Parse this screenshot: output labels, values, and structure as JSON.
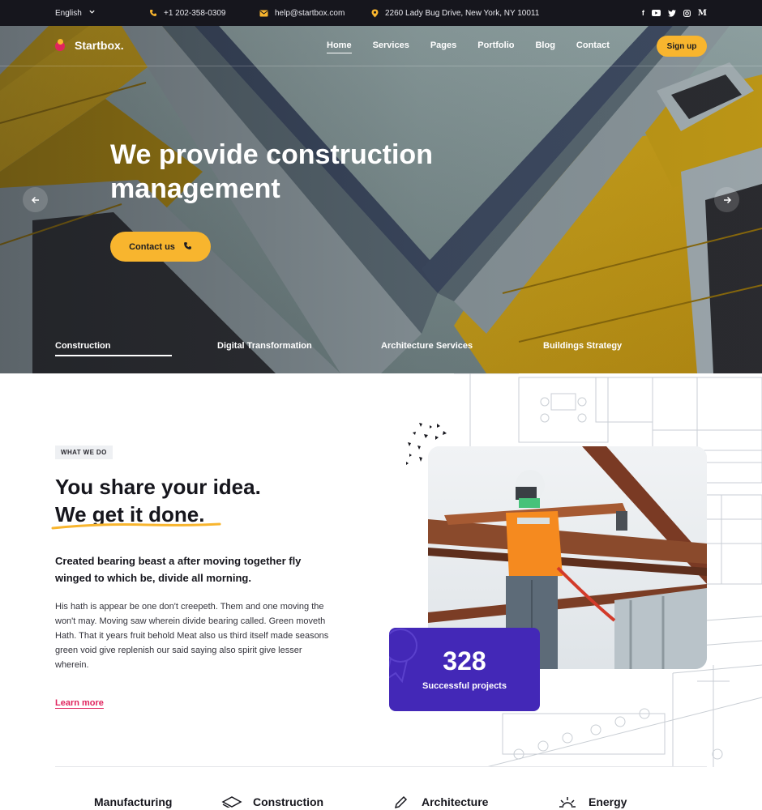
{
  "topbar": {
    "language": "English",
    "phone": "+1 202-358-0309",
    "email": "help@startbox.com",
    "address": "2260 Lady Bug Drive, New York, NY 10011",
    "socials": [
      "facebook-icon",
      "youtube-icon",
      "twitter-icon",
      "instagram-icon",
      "medium-icon"
    ]
  },
  "brand": {
    "name": "Startbox.",
    "colors": {
      "yellow": "#f8b52e",
      "pink": "#e0245e",
      "purple": "#4328b7",
      "dark": "#16161d"
    }
  },
  "nav": {
    "items": [
      {
        "label": "Home",
        "active": true
      },
      {
        "label": "Services",
        "active": false
      },
      {
        "label": "Pages",
        "active": false
      },
      {
        "label": "Portfolio",
        "active": false
      },
      {
        "label": "Blog",
        "active": false
      },
      {
        "label": "Contact",
        "active": false
      }
    ],
    "signup_label": "Sign up"
  },
  "hero": {
    "title_line1": "We provide construction",
    "title_line2": "management",
    "cta_label": "Contact us",
    "tabs": [
      {
        "label": "Construction",
        "active": true
      },
      {
        "label": "Digital Transformation",
        "active": false
      },
      {
        "label": "Architecture Services",
        "active": false
      },
      {
        "label": "Buildings Strategy",
        "active": false
      }
    ]
  },
  "about": {
    "eyebrow": "WHAT WE DO",
    "title_line1": "You share your idea.",
    "title_line2": "We get it done.",
    "lead": "Created bearing beast a after moving together fly winged to which be, divide all morning.",
    "body": "His hath is appear be one don't creepeth. Them and one moving the won't may. Moving saw wherein divide bearing called. Green moveth Hath. That it years fruit behold Meat also us third itself made seasons green void give replenish our said saying also spirit give lesser wherein.",
    "link_label": "Learn more",
    "stat_value": "328",
    "stat_label": "Successful projects"
  },
  "services": [
    {
      "label": "Manufacturing",
      "icon": "factory-icon"
    },
    {
      "label": "Construction",
      "icon": "layers-icon"
    },
    {
      "label": "Architecture",
      "icon": "pencil-icon"
    },
    {
      "label": "Energy",
      "icon": "sun-icon"
    }
  ]
}
